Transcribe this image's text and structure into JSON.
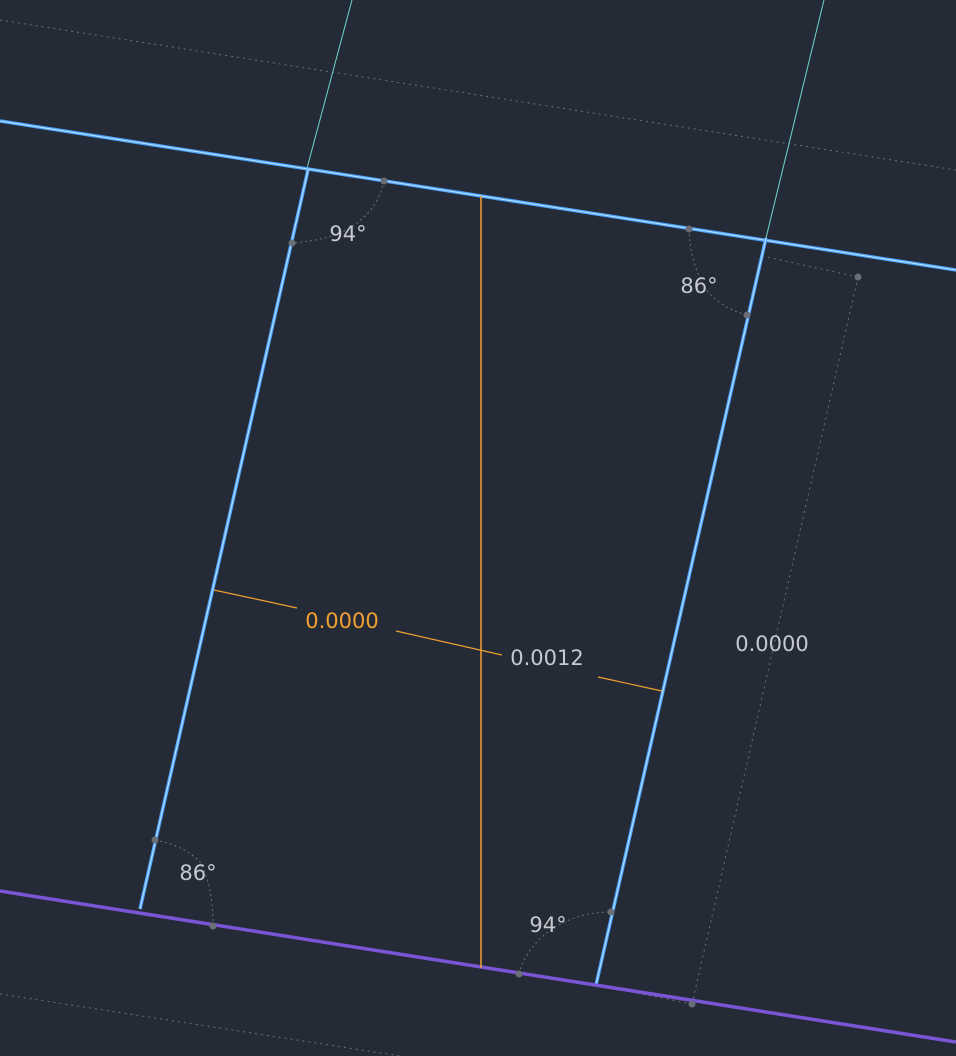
{
  "colors": {
    "background": "#252b36",
    "wall_line": "#4da3ff",
    "wall_glow": "#bfe4ff",
    "base_line": "#7a55d6",
    "guide_line": "#6fd6cf",
    "orange": "#f0a030",
    "label_gray": "#c6c9cf",
    "dotted": "#6a707a",
    "handle": "#6a6e76"
  },
  "dimensions": {
    "selected": "0.0000",
    "middle": "0.0012",
    "right": "0.0000"
  },
  "angles": {
    "top_left": "94°",
    "top_right": "86°",
    "bottom_left": "86°",
    "bottom_right": "94°"
  }
}
